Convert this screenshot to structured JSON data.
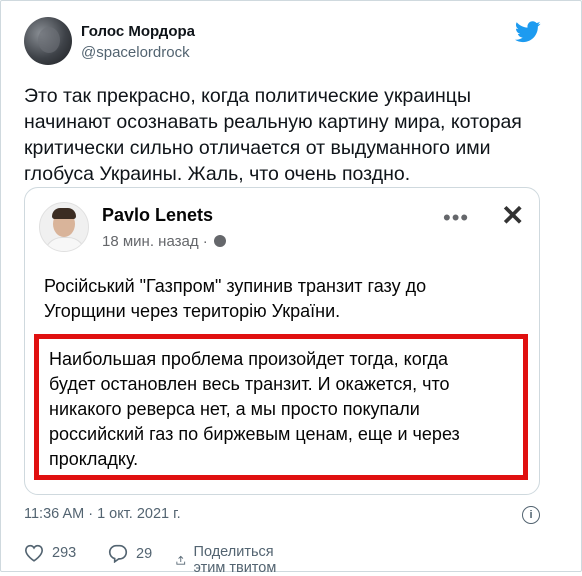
{
  "author": {
    "name": "Голос Мордора",
    "handle": "@spacelordrock"
  },
  "tweet_text": "Это так прекрасно, когда политические украинцы\nначинают осознавать реальную картину мира, которая\nкритически сильно отличается от выдуманного ими\nглобуса Украины. Жаль, что очень поздно.",
  "quoted_post": {
    "author_name": "Pavlo Lenets",
    "time_ago": "18 мин. назад ·",
    "text": "Російський \"Газпром\" зупинив транзит газу до\nУгорщини через територію України.",
    "highlighted_text": "Наибольшая проблема произойдет тогда, когда\nбудет остановлен весь транзит. И окажется, что\nникакого реверса нет, а мы просто покупали\nроссийский газ по биржевым ценам, еще и через\nпрокладку."
  },
  "timestamp": "11:36 AM · 1 окт. 2021 г.",
  "actions": {
    "likes": "293",
    "replies": "29",
    "share_label": "Поделиться этим твитом"
  },
  "colors": {
    "twitter_blue": "#1d9bf0",
    "highlight_red": "#e01010",
    "secondary_text": "#536471"
  }
}
